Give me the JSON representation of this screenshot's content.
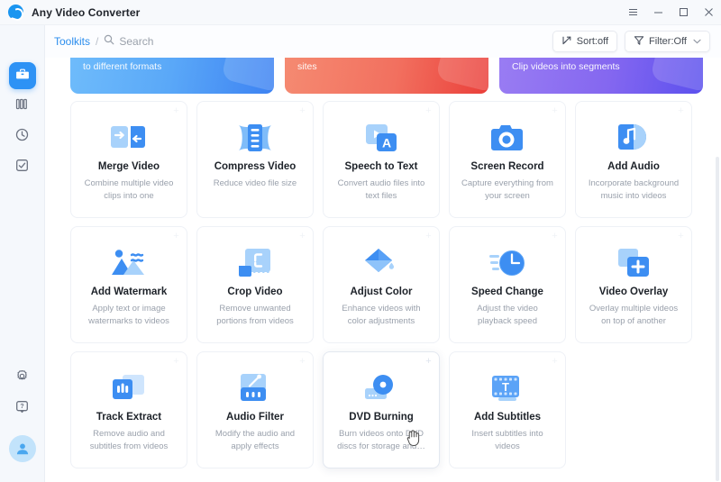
{
  "window": {
    "app_title": "Any Video Converter",
    "logo_icon": "app-logo-icon",
    "controls": [
      {
        "name": "menu-icon",
        "label": "≡"
      },
      {
        "name": "minimize-icon",
        "label": "–"
      },
      {
        "name": "maximize-icon",
        "label": "□"
      },
      {
        "name": "close-icon",
        "label": "✕"
      }
    ]
  },
  "toolbar": {
    "collapse_icon": "collapse-sidebar-icon",
    "breadcrumb": "Toolkits",
    "breadcrumb_sep": "/",
    "search_icon": "search-icon",
    "search_placeholder": "Search",
    "search_value": "",
    "sort_label": "Sort:off",
    "sort_icon": "sort-icon",
    "filter_label": "Filter:Off",
    "filter_icon": "filter-icon",
    "filter_caret": "∨"
  },
  "sidebar": {
    "items": [
      {
        "name": "sidebar-item-toolkits",
        "icon": "toolbox-icon",
        "active": true
      },
      {
        "name": "sidebar-item-library",
        "icon": "library-icon",
        "active": false
      },
      {
        "name": "sidebar-item-history",
        "icon": "clock-icon",
        "active": false
      },
      {
        "name": "sidebar-item-tasks",
        "icon": "tasks-icon",
        "active": false
      }
    ],
    "bottom": [
      {
        "name": "sidebar-item-settings",
        "icon": "gear-icon"
      },
      {
        "name": "sidebar-item-help",
        "icon": "help-icon"
      }
    ],
    "avatar_icon": "user-avatar-icon"
  },
  "banners": [
    {
      "text": "to different formats",
      "color": "#4f9bf6"
    },
    {
      "text": "sites",
      "color": "#ee5c4d"
    },
    {
      "text": "Clip videos into segments",
      "color": "#7a63f0"
    }
  ],
  "cards": [
    {
      "title": "Merge Video",
      "desc": "Combine multiple video clips into one",
      "icon": "merge-video-icon",
      "hovered": false
    },
    {
      "title": "Compress Video",
      "desc": "Reduce video file size",
      "icon": "compress-video-icon",
      "hovered": false
    },
    {
      "title": "Speech to Text",
      "desc": "Convert audio files into text files",
      "icon": "speech-to-text-icon",
      "hovered": false
    },
    {
      "title": "Screen Record",
      "desc": "Capture everything from your screen",
      "icon": "screen-record-icon",
      "hovered": false
    },
    {
      "title": "Add Audio",
      "desc": "Incorporate background music into videos",
      "icon": "add-audio-icon",
      "hovered": false
    },
    {
      "title": "Add Watermark",
      "desc": "Apply text or image watermarks to videos",
      "icon": "add-watermark-icon",
      "hovered": false
    },
    {
      "title": "Crop Video",
      "desc": "Remove unwanted portions from videos",
      "icon": "crop-video-icon",
      "hovered": false
    },
    {
      "title": "Adjust Color",
      "desc": "Enhance videos with color adjustments",
      "icon": "adjust-color-icon",
      "hovered": false
    },
    {
      "title": "Speed Change",
      "desc": "Adjust the video playback speed",
      "icon": "speed-change-icon",
      "hovered": false
    },
    {
      "title": "Video Overlay",
      "desc": "Overlay multiple videos on top of another",
      "icon": "video-overlay-icon",
      "hovered": false
    },
    {
      "title": "Track Extract",
      "desc": "Remove audio and subtitles from videos",
      "icon": "track-extract-icon",
      "hovered": false
    },
    {
      "title": "Audio Filter",
      "desc": "Modify the audio and apply effects",
      "icon": "audio-filter-icon",
      "hovered": false
    },
    {
      "title": "DVD Burning",
      "desc": "Burn videos onto DVD discs for storage and…",
      "icon": "dvd-burning-icon",
      "hovered": true
    },
    {
      "title": "Add Subtitles",
      "desc": "Insert subtitles into videos",
      "icon": "add-subtitles-icon",
      "hovered": false
    }
  ],
  "card_pin_label": "+"
}
